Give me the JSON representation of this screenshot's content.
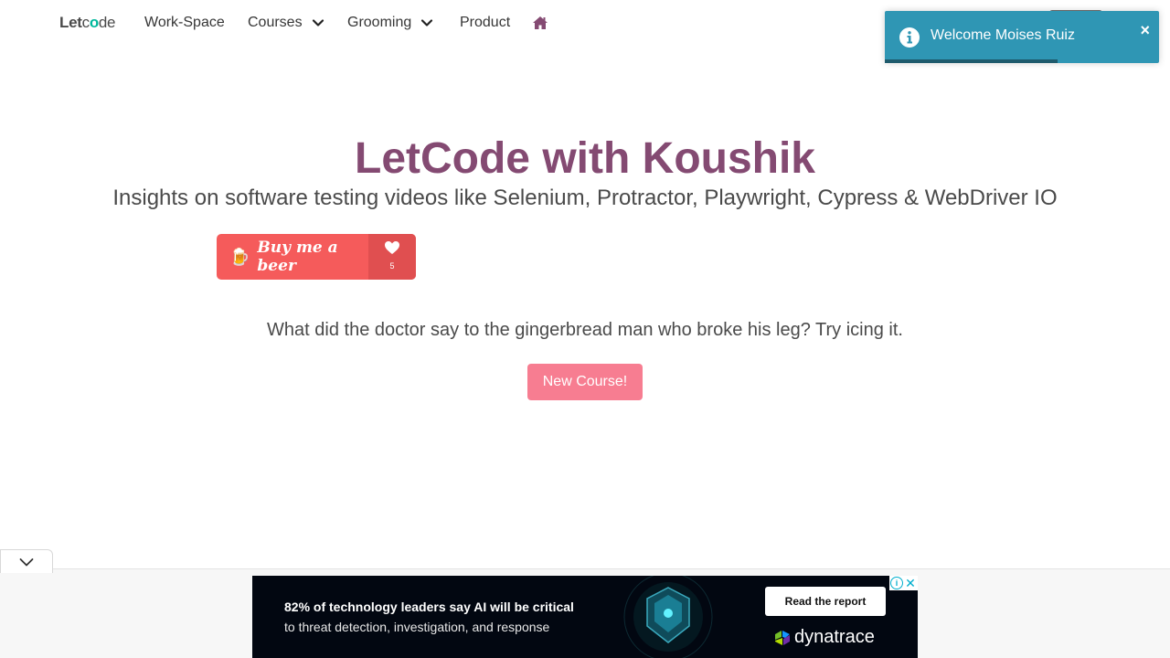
{
  "navbar": {
    "logo_let": "Let",
    "logo_c": "c",
    "logo_o": "o",
    "logo_de": "de",
    "items": [
      {
        "label": "Work-Space"
      },
      {
        "label": "Courses",
        "has_dropdown": true
      },
      {
        "label": "Grooming",
        "has_dropdown": true
      },
      {
        "label": "Product"
      }
    ],
    "home_icon": "home-icon"
  },
  "toast": {
    "message": "Welcome Moises Ruiz",
    "close": "×",
    "icon": "info-icon",
    "color": "#2f96b4",
    "progress": 0.63
  },
  "hero": {
    "title": "LetCode with Koushik",
    "subtitle": "Insights on software testing videos like Selenium, Protractor, Playwright, Cypress & WebDriver IO",
    "title_color": "#844a72"
  },
  "buy_beer": {
    "emoji": "🍺",
    "label": "Buy me a beer",
    "count": "5",
    "color": "#f55b5b"
  },
  "joke": "What did the doctor say to the gingerbread man who broke his leg? Try icing it.",
  "new_course_button": "New Course!",
  "ad": {
    "line1": "82% of technology leaders say AI will be critical",
    "line2": "to threat detection, investigation, and response",
    "cta": "Read the report",
    "brand": "dynatrace",
    "adchoices_info": "i",
    "adchoices_close": "✕"
  }
}
